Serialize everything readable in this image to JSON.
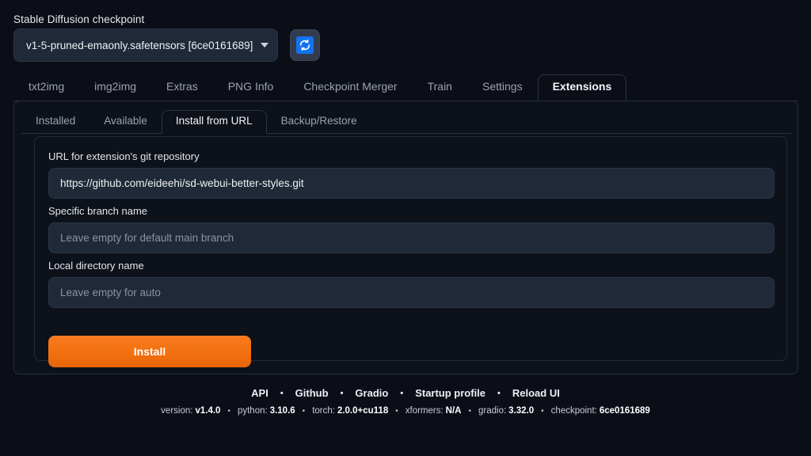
{
  "checkpoint": {
    "label": "Stable Diffusion checkpoint",
    "value": "v1-5-pruned-emaonly.safetensors [6ce0161689]",
    "refresh_icon": "refresh-icon",
    "caret_icon": "chevron-down-icon",
    "accent_blue": "#1174ef"
  },
  "main_tabs": [
    {
      "label": "txt2img",
      "active": false
    },
    {
      "label": "img2img",
      "active": false
    },
    {
      "label": "Extras",
      "active": false
    },
    {
      "label": "PNG Info",
      "active": false
    },
    {
      "label": "Checkpoint Merger",
      "active": false
    },
    {
      "label": "Train",
      "active": false
    },
    {
      "label": "Settings",
      "active": false
    },
    {
      "label": "Extensions",
      "active": true
    }
  ],
  "sub_tabs": [
    {
      "label": "Installed",
      "active": false
    },
    {
      "label": "Available",
      "active": false
    },
    {
      "label": "Install from URL",
      "active": true
    },
    {
      "label": "Backup/Restore",
      "active": false
    }
  ],
  "form": {
    "url_field": {
      "label": "URL for extension's git repository",
      "value": "https://github.com/eideehi/sd-webui-better-styles.git",
      "placeholder": ""
    },
    "branch_field": {
      "label": "Specific branch name",
      "value": "",
      "placeholder": "Leave empty for default main branch"
    },
    "dir_field": {
      "label": "Local directory name",
      "value": "",
      "placeholder": "Leave empty for auto"
    },
    "install_button": "Install",
    "install_color": "#f2700f"
  },
  "footer": {
    "links": [
      "API",
      "Github",
      "Gradio",
      "Startup profile",
      "Reload UI"
    ],
    "separator": "•",
    "version_items": [
      {
        "key": "version:",
        "value": "v1.4.0"
      },
      {
        "key": "python:",
        "value": "3.10.6"
      },
      {
        "key": "torch:",
        "value": "2.0.0+cu118"
      },
      {
        "key": "xformers:",
        "value": "N/A"
      },
      {
        "key": "gradio:",
        "value": "3.32.0"
      },
      {
        "key": "checkpoint:",
        "value": "6ce0161689"
      }
    ]
  }
}
